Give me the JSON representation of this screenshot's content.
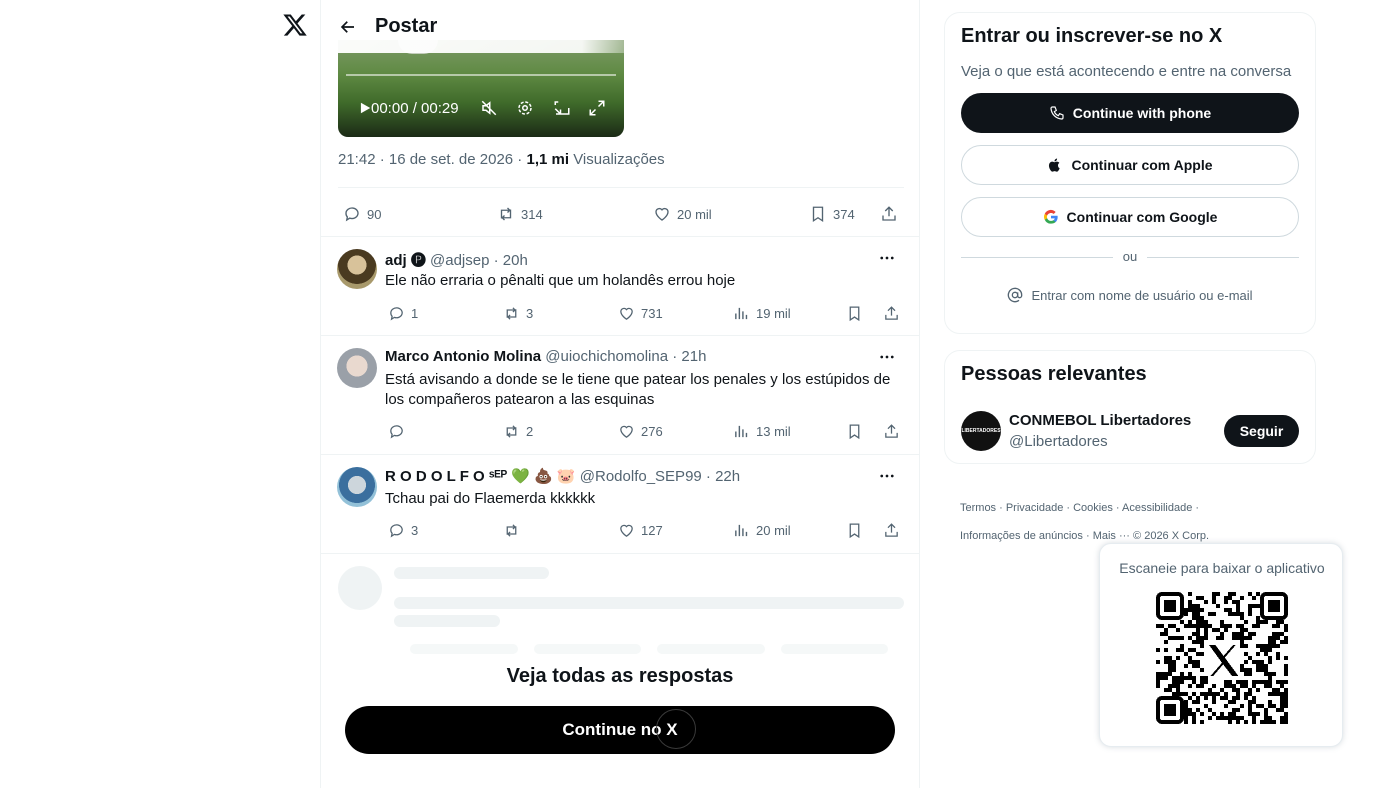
{
  "header": {
    "title": "Postar"
  },
  "video": {
    "time": "00:00 / 00:29"
  },
  "post": {
    "time": "21:42 · 16 de set. de 2026 ·",
    "views_count": "1,1 mi",
    "views_label": "Visualizações",
    "actions": {
      "replies": "90",
      "reposts": "314",
      "likes": "20 mil",
      "bookmarks": "374"
    }
  },
  "replies": [
    {
      "name": "adj 🅟",
      "handle": "@adjsep · 20h",
      "text": "Ele não erraria o pênalti que um holandês errou hoje",
      "replies": "1",
      "reposts": "3",
      "likes": "731",
      "views": "19 mil"
    },
    {
      "name": "Marco Antonio Molina",
      "handle": "@uiochichomolina · 21h",
      "text": "Está avisando a donde se le tiene que patear los penales y los estúpidos de los compañeros patearon a las esquinas",
      "replies": "",
      "reposts": "2",
      "likes": "276",
      "views": "13 mil"
    },
    {
      "name": "R O D O L F O ˢᴱᴾ 💚 💩 🐷",
      "handle": "@Rodolfo_SEP99 · 22h",
      "text": "Tchau pai do Flaemerda kkkkkk",
      "replies": "3",
      "reposts": "",
      "likes": "127",
      "views": "20 mil"
    }
  ],
  "see_all": "Veja todas as respostas",
  "continue_button": "Continue no X",
  "signup": {
    "title": "Entrar ou inscrever-se no X",
    "subtitle": "Veja o que está acontecendo e entre na conversa",
    "phone": "Continue with phone",
    "apple": "Continuar com Apple",
    "google": "Continuar com Google",
    "or": "ou",
    "username": "Entrar com nome de usuário ou e-mail"
  },
  "people": {
    "title": "Pessoas relevantes",
    "name": "CONMEBOL Libertadores",
    "handle": "@Libertadores",
    "follow": "Seguir",
    "avatar_text": "LIBERTADORES"
  },
  "footer": {
    "links": [
      "Termos",
      "Privacidade",
      "Cookies",
      "Acessibilidade",
      "Informações de anúncios",
      "Mais ···"
    ],
    "copyright": "© 2026 X Corp."
  },
  "qr": {
    "caption": "Escaneie para baixar o aplicativo"
  },
  "colors": {
    "text": "#0f1419",
    "secondary": "#536471",
    "border": "#eff3f4",
    "brand": "#000000"
  },
  "icons": [
    "x-logo-icon",
    "back-arrow-icon",
    "reply-icon",
    "repost-icon",
    "like-icon",
    "bookmark-icon",
    "share-icon",
    "views-icon",
    "more-icon",
    "phone-icon",
    "apple-icon",
    "google-icon",
    "at-icon",
    "play-icon",
    "mute-icon",
    "settings-icon",
    "pip-icon",
    "fullscreen-icon"
  ]
}
